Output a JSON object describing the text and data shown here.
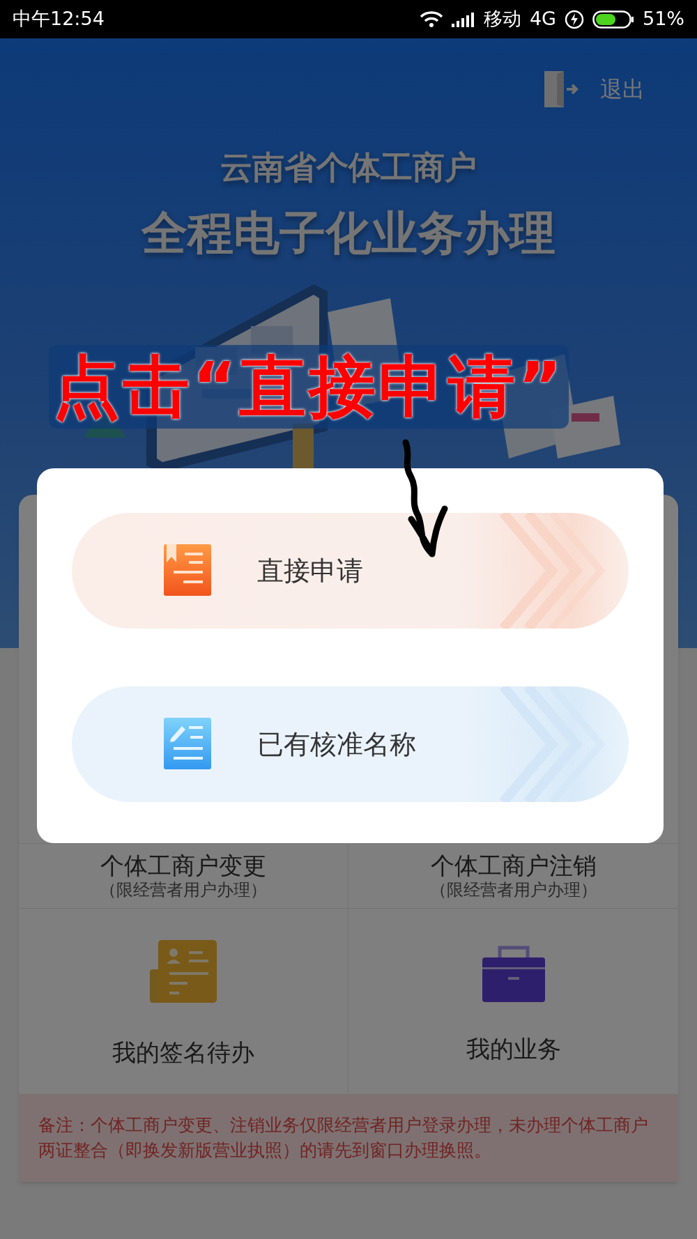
{
  "status_bar": {
    "time": "中午12:54",
    "carrier": "移动",
    "network": "4G",
    "battery": "51%"
  },
  "header": {
    "exit": "退出",
    "title": "云南省个体工商户",
    "subtitle": "全程电子化业务办理"
  },
  "annotation": {
    "text": "点击“直接申请”"
  },
  "dialog": {
    "options": [
      {
        "label": "直接申请",
        "kind": "apply"
      },
      {
        "label": "已有核准名称",
        "kind": "approved"
      }
    ]
  },
  "grid": [
    {
      "title": "个体工商户变更",
      "note": "（限经营者用户办理）"
    },
    {
      "title": "个体工商户注销",
      "note": "（限经营者用户办理）"
    },
    {
      "title": "我的签名待办",
      "kind": "signature"
    },
    {
      "title": "我的业务",
      "kind": "briefcase"
    }
  ],
  "remark": "备注：个体工商户变更、注销业务仅限经营者用户登录办理，未办理个体工商户两证整合（即换发新版营业执照）的请先到窗口办理换照。"
}
